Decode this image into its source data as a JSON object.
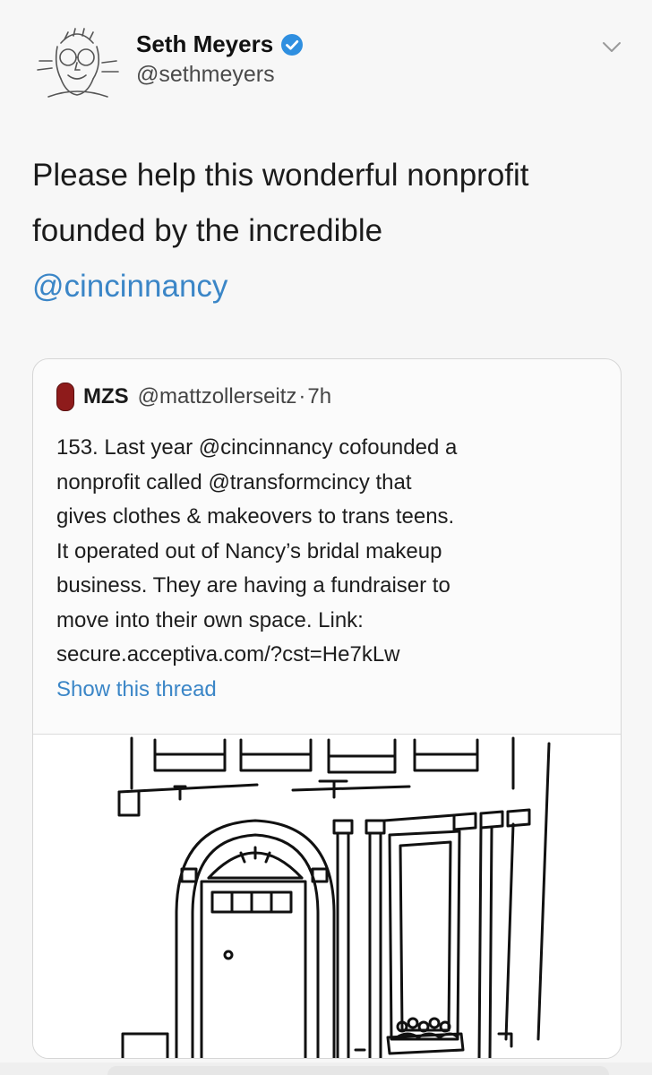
{
  "tweet": {
    "display_name": "Seth Meyers",
    "handle": "@sethmeyers",
    "text_line1": "Please help this wonderful nonprofit",
    "text_line2": "founded by the incredible",
    "mention": "@cincinnancy",
    "icons": {
      "avatar": "caricature-avatar",
      "verified": "verified-badge-icon",
      "menu": "chevron-down-icon"
    }
  },
  "quote": {
    "name": "MZS",
    "handle": "@mattzollerseitz",
    "separator": "·",
    "time": "7h",
    "lines": [
      "153. Last year @cincinnancy cofounded a",
      "nonprofit called @transformcincy that",
      "gives clothes & makeovers to trans teens.",
      "It operated out of Nancy’s bridal makeup",
      "business. They are having a fundraiser to",
      "move into their own space. Link:",
      "secure.acceptiva.com/?cst=He7kLw"
    ],
    "show_thread": "Show this thread",
    "image": "building-facade-drawing"
  },
  "colors": {
    "link": "#3b86c7",
    "verified": "#2f8fe0",
    "quote_avatar": "#8e1b1b"
  }
}
